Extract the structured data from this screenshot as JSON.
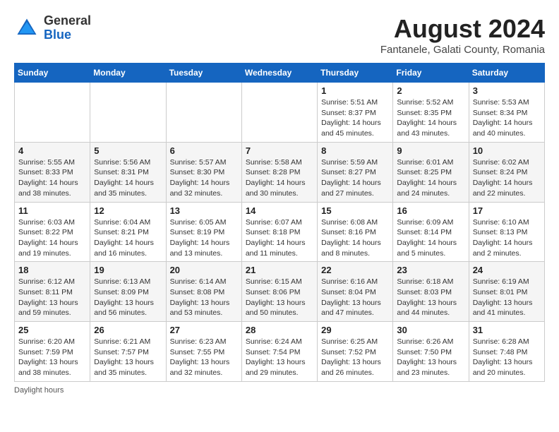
{
  "header": {
    "logo_general": "General",
    "logo_blue": "Blue",
    "month_year": "August 2024",
    "location": "Fantanele, Galati County, Romania"
  },
  "days_of_week": [
    "Sunday",
    "Monday",
    "Tuesday",
    "Wednesday",
    "Thursday",
    "Friday",
    "Saturday"
  ],
  "footer": {
    "daylight_label": "Daylight hours"
  },
  "weeks": [
    [
      {
        "day": "",
        "info": ""
      },
      {
        "day": "",
        "info": ""
      },
      {
        "day": "",
        "info": ""
      },
      {
        "day": "",
        "info": ""
      },
      {
        "day": "1",
        "info": "Sunrise: 5:51 AM\nSunset: 8:37 PM\nDaylight: 14 hours and 45 minutes."
      },
      {
        "day": "2",
        "info": "Sunrise: 5:52 AM\nSunset: 8:35 PM\nDaylight: 14 hours and 43 minutes."
      },
      {
        "day": "3",
        "info": "Sunrise: 5:53 AM\nSunset: 8:34 PM\nDaylight: 14 hours and 40 minutes."
      }
    ],
    [
      {
        "day": "4",
        "info": "Sunrise: 5:55 AM\nSunset: 8:33 PM\nDaylight: 14 hours and 38 minutes."
      },
      {
        "day": "5",
        "info": "Sunrise: 5:56 AM\nSunset: 8:31 PM\nDaylight: 14 hours and 35 minutes."
      },
      {
        "day": "6",
        "info": "Sunrise: 5:57 AM\nSunset: 8:30 PM\nDaylight: 14 hours and 32 minutes."
      },
      {
        "day": "7",
        "info": "Sunrise: 5:58 AM\nSunset: 8:28 PM\nDaylight: 14 hours and 30 minutes."
      },
      {
        "day": "8",
        "info": "Sunrise: 5:59 AM\nSunset: 8:27 PM\nDaylight: 14 hours and 27 minutes."
      },
      {
        "day": "9",
        "info": "Sunrise: 6:01 AM\nSunset: 8:25 PM\nDaylight: 14 hours and 24 minutes."
      },
      {
        "day": "10",
        "info": "Sunrise: 6:02 AM\nSunset: 8:24 PM\nDaylight: 14 hours and 22 minutes."
      }
    ],
    [
      {
        "day": "11",
        "info": "Sunrise: 6:03 AM\nSunset: 8:22 PM\nDaylight: 14 hours and 19 minutes."
      },
      {
        "day": "12",
        "info": "Sunrise: 6:04 AM\nSunset: 8:21 PM\nDaylight: 14 hours and 16 minutes."
      },
      {
        "day": "13",
        "info": "Sunrise: 6:05 AM\nSunset: 8:19 PM\nDaylight: 14 hours and 13 minutes."
      },
      {
        "day": "14",
        "info": "Sunrise: 6:07 AM\nSunset: 8:18 PM\nDaylight: 14 hours and 11 minutes."
      },
      {
        "day": "15",
        "info": "Sunrise: 6:08 AM\nSunset: 8:16 PM\nDaylight: 14 hours and 8 minutes."
      },
      {
        "day": "16",
        "info": "Sunrise: 6:09 AM\nSunset: 8:14 PM\nDaylight: 14 hours and 5 minutes."
      },
      {
        "day": "17",
        "info": "Sunrise: 6:10 AM\nSunset: 8:13 PM\nDaylight: 14 hours and 2 minutes."
      }
    ],
    [
      {
        "day": "18",
        "info": "Sunrise: 6:12 AM\nSunset: 8:11 PM\nDaylight: 13 hours and 59 minutes."
      },
      {
        "day": "19",
        "info": "Sunrise: 6:13 AM\nSunset: 8:09 PM\nDaylight: 13 hours and 56 minutes."
      },
      {
        "day": "20",
        "info": "Sunrise: 6:14 AM\nSunset: 8:08 PM\nDaylight: 13 hours and 53 minutes."
      },
      {
        "day": "21",
        "info": "Sunrise: 6:15 AM\nSunset: 8:06 PM\nDaylight: 13 hours and 50 minutes."
      },
      {
        "day": "22",
        "info": "Sunrise: 6:16 AM\nSunset: 8:04 PM\nDaylight: 13 hours and 47 minutes."
      },
      {
        "day": "23",
        "info": "Sunrise: 6:18 AM\nSunset: 8:03 PM\nDaylight: 13 hours and 44 minutes."
      },
      {
        "day": "24",
        "info": "Sunrise: 6:19 AM\nSunset: 8:01 PM\nDaylight: 13 hours and 41 minutes."
      }
    ],
    [
      {
        "day": "25",
        "info": "Sunrise: 6:20 AM\nSunset: 7:59 PM\nDaylight: 13 hours and 38 minutes."
      },
      {
        "day": "26",
        "info": "Sunrise: 6:21 AM\nSunset: 7:57 PM\nDaylight: 13 hours and 35 minutes."
      },
      {
        "day": "27",
        "info": "Sunrise: 6:23 AM\nSunset: 7:55 PM\nDaylight: 13 hours and 32 minutes."
      },
      {
        "day": "28",
        "info": "Sunrise: 6:24 AM\nSunset: 7:54 PM\nDaylight: 13 hours and 29 minutes."
      },
      {
        "day": "29",
        "info": "Sunrise: 6:25 AM\nSunset: 7:52 PM\nDaylight: 13 hours and 26 minutes."
      },
      {
        "day": "30",
        "info": "Sunrise: 6:26 AM\nSunset: 7:50 PM\nDaylight: 13 hours and 23 minutes."
      },
      {
        "day": "31",
        "info": "Sunrise: 6:28 AM\nSunset: 7:48 PM\nDaylight: 13 hours and 20 minutes."
      }
    ]
  ]
}
